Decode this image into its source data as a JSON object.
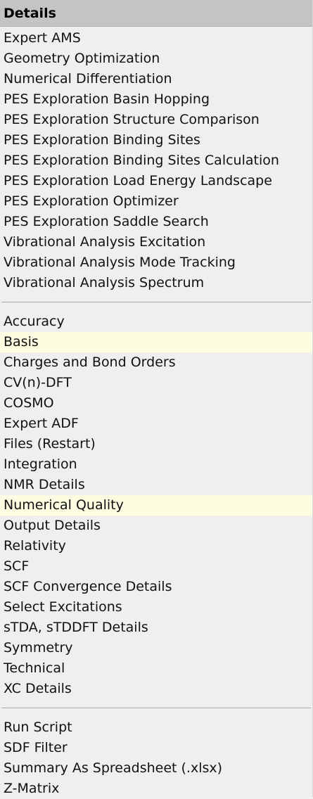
{
  "menu": {
    "title": "Details",
    "groups": [
      {
        "items": [
          {
            "label": "Expert AMS",
            "highlighted": false
          },
          {
            "label": "Geometry Optimization",
            "highlighted": false
          },
          {
            "label": "Numerical Differentiation",
            "highlighted": false
          },
          {
            "label": "PES Exploration Basin Hopping",
            "highlighted": false
          },
          {
            "label": "PES Exploration Structure Comparison",
            "highlighted": false
          },
          {
            "label": "PES Exploration Binding Sites",
            "highlighted": false
          },
          {
            "label": "PES Exploration Binding Sites Calculation",
            "highlighted": false
          },
          {
            "label": "PES Exploration Load Energy Landscape",
            "highlighted": false
          },
          {
            "label": "PES Exploration Optimizer",
            "highlighted": false
          },
          {
            "label": "PES Exploration Saddle Search",
            "highlighted": false
          },
          {
            "label": "Vibrational Analysis Excitation",
            "highlighted": false
          },
          {
            "label": "Vibrational Analysis Mode Tracking",
            "highlighted": false
          },
          {
            "label": "Vibrational Analysis Spectrum",
            "highlighted": false
          }
        ]
      },
      {
        "items": [
          {
            "label": "Accuracy",
            "highlighted": false
          },
          {
            "label": "Basis",
            "highlighted": true
          },
          {
            "label": "Charges and Bond Orders",
            "highlighted": false
          },
          {
            "label": "CV(n)-DFT",
            "highlighted": false
          },
          {
            "label": "COSMO",
            "highlighted": false
          },
          {
            "label": "Expert ADF",
            "highlighted": false
          },
          {
            "label": "Files (Restart)",
            "highlighted": false
          },
          {
            "label": "Integration",
            "highlighted": false
          },
          {
            "label": "NMR Details",
            "highlighted": false
          },
          {
            "label": "Numerical Quality",
            "highlighted": true
          },
          {
            "label": "Output Details",
            "highlighted": false
          },
          {
            "label": "Relativity",
            "highlighted": false
          },
          {
            "label": "SCF",
            "highlighted": false
          },
          {
            "label": "SCF Convergence Details",
            "highlighted": false
          },
          {
            "label": "Select Excitations",
            "highlighted": false
          },
          {
            "label": "sTDA, sTDDFT Details",
            "highlighted": false
          },
          {
            "label": "Symmetry",
            "highlighted": false
          },
          {
            "label": "Technical",
            "highlighted": false
          },
          {
            "label": "XC Details",
            "highlighted": false
          }
        ]
      },
      {
        "items": [
          {
            "label": "Run Script",
            "highlighted": false
          },
          {
            "label": "SDF Filter",
            "highlighted": false
          },
          {
            "label": "Summary As Spreadsheet (.xlsx)",
            "highlighted": false
          },
          {
            "label": "Z-Matrix",
            "highlighted": false
          }
        ]
      }
    ]
  },
  "colors": {
    "background": "#efefef",
    "header": "#c4c4c4",
    "highlight": "#fdfde2",
    "separator": "#a8a8a8"
  }
}
